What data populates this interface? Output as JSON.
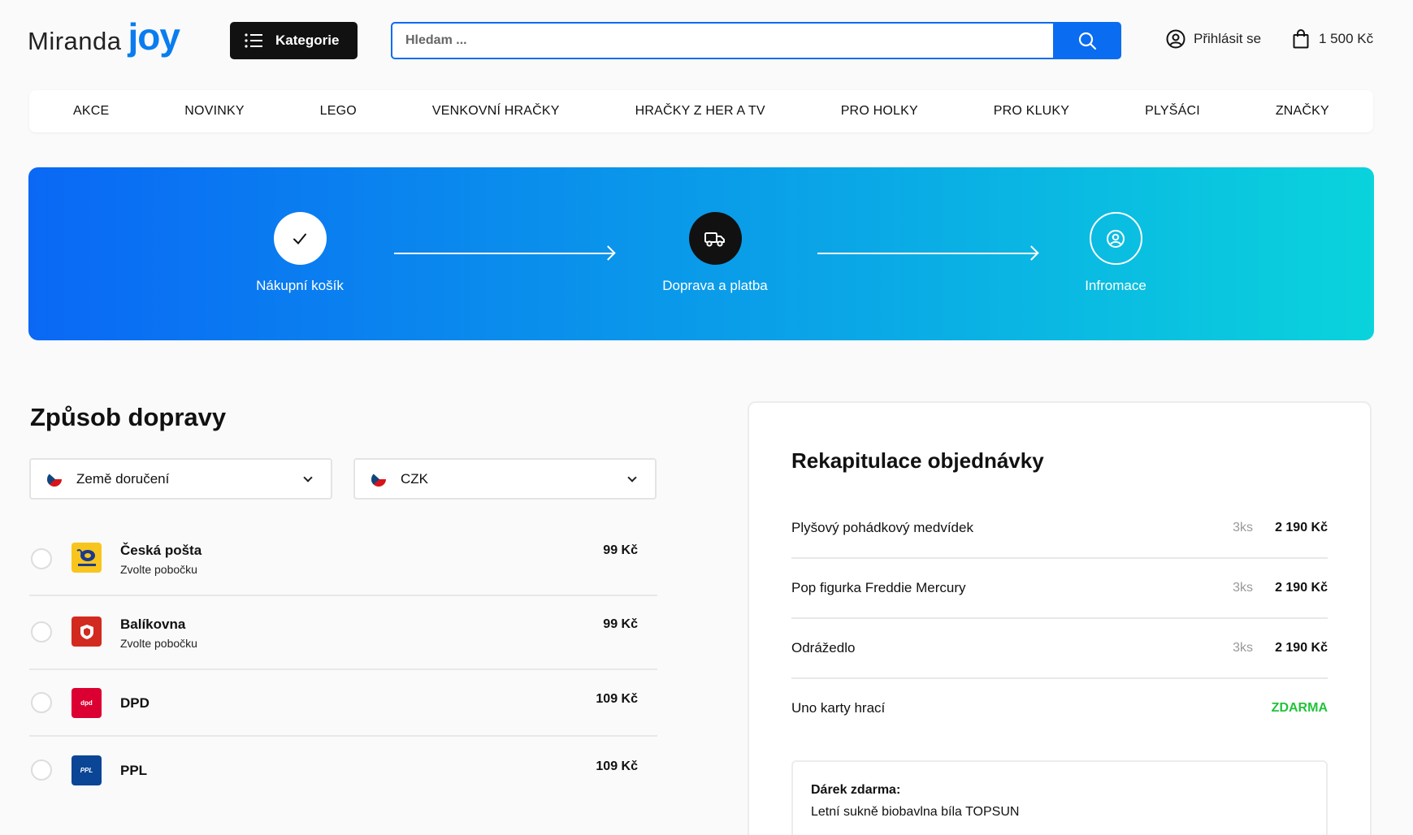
{
  "header": {
    "logo_left": "Miranda",
    "logo_right": "joy",
    "categories_label": "Kategorie",
    "search_placeholder": "Hledam ...",
    "login_label": "Přihlásit se",
    "cart_total": "1 500 Kč"
  },
  "nav": {
    "items": [
      "AKCE",
      "NOVINKY",
      "LEGO",
      "VENKOVNÍ HRAČKY",
      "HRAČKY Z HER A TV",
      "PRO HOLKY",
      "PRO KLUKY",
      "PLYŠÁCI",
      "ZNAČKY"
    ]
  },
  "steps": [
    {
      "label": "Nákupní košík",
      "state": "done"
    },
    {
      "label": "Doprava a platba",
      "state": "active"
    },
    {
      "label": "Infromace",
      "state": "pending"
    }
  ],
  "delivery": {
    "title": "Způsob dopravy",
    "country_select": "Země doručení",
    "currency_select": "CZK",
    "carriers": [
      {
        "name": "Česká pošta",
        "sub": "Zvolte pobočku",
        "price": "99 Kč",
        "logo_text": "Česká pošta",
        "color": "#f7c51e"
      },
      {
        "name": "Balíkovna",
        "sub": "Zvolte pobočku",
        "price": "99 Kč",
        "logo_text": "",
        "color": "#d22a1f"
      },
      {
        "name": "DPD",
        "sub": "",
        "price": "109 Kč",
        "logo_text": "dpd",
        "color": "#dc0032"
      },
      {
        "name": "PPL",
        "sub": "",
        "price": "109 Kč",
        "logo_text": "PPL",
        "color": "#0b4596"
      }
    ]
  },
  "summary": {
    "title": "Rekapitulace objednávky",
    "items": [
      {
        "name": "Plyšový pohádkový medvídek",
        "qty": "3ks",
        "price": "2 190 Kč"
      },
      {
        "name": "Pop figurka Freddie Mercury",
        "qty": "3ks",
        "price": "2 190 Kč"
      },
      {
        "name": "Odrážedlo",
        "qty": "3ks",
        "price": "2 190 Kč"
      },
      {
        "name": "Uno karty hrací",
        "qty": "",
        "price": "ZDARMA"
      }
    ],
    "gift_title": "Dárek zdarma:",
    "gift_value": "Letní sukně biobavlna bíla TOPSUN"
  },
  "colors": {
    "accent": "#0a6cf0",
    "free": "#22c33a",
    "gradient_start": "#0a68f5",
    "gradient_end": "#0ad3dc"
  }
}
